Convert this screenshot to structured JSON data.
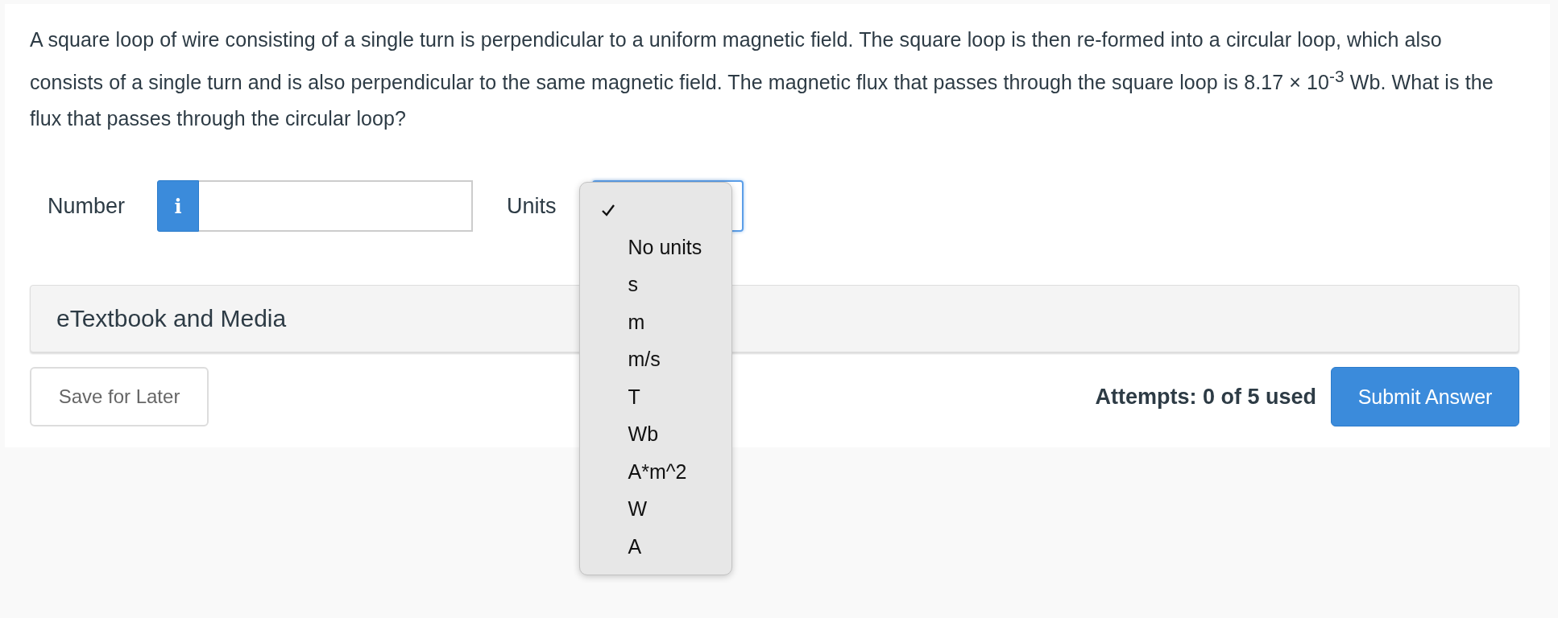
{
  "question": {
    "text": "A square loop of wire consisting of a single turn is perpendicular to a uniform magnetic field. The square loop is then re-formed into a circular loop, which also consists of a single turn and is also perpendicular to the same magnetic field. The magnetic flux that passes through the square loop is 8.17 × 10$^{-3}$ Wb. What is the flux that passes through the circular loop?"
  },
  "answer_row": {
    "number_label": "Number",
    "info_button": "i",
    "units_label": "Units",
    "units_menu": [
      {
        "selected": true
      },
      {
        "label": "No units",
        "selected": false
      },
      {
        "label": "s",
        "selected": false
      },
      {
        "label": "m",
        "selected": false
      },
      {
        "label": "m/s",
        "selected": false
      },
      {
        "label": "T",
        "selected": false
      },
      {
        "label": "Wb",
        "selected": false
      },
      {
        "label": "A*m^2",
        "selected": false
      },
      {
        "label": "W",
        "selected": false
      },
      {
        "label": "A",
        "selected": false
      }
    ]
  },
  "media_panel": {
    "title": "eTextbook and Media"
  },
  "footer": {
    "save_button": "Save for Later",
    "attempts": "Attempts: 0 of 5 used",
    "submit_button": "Submit Answer"
  }
}
